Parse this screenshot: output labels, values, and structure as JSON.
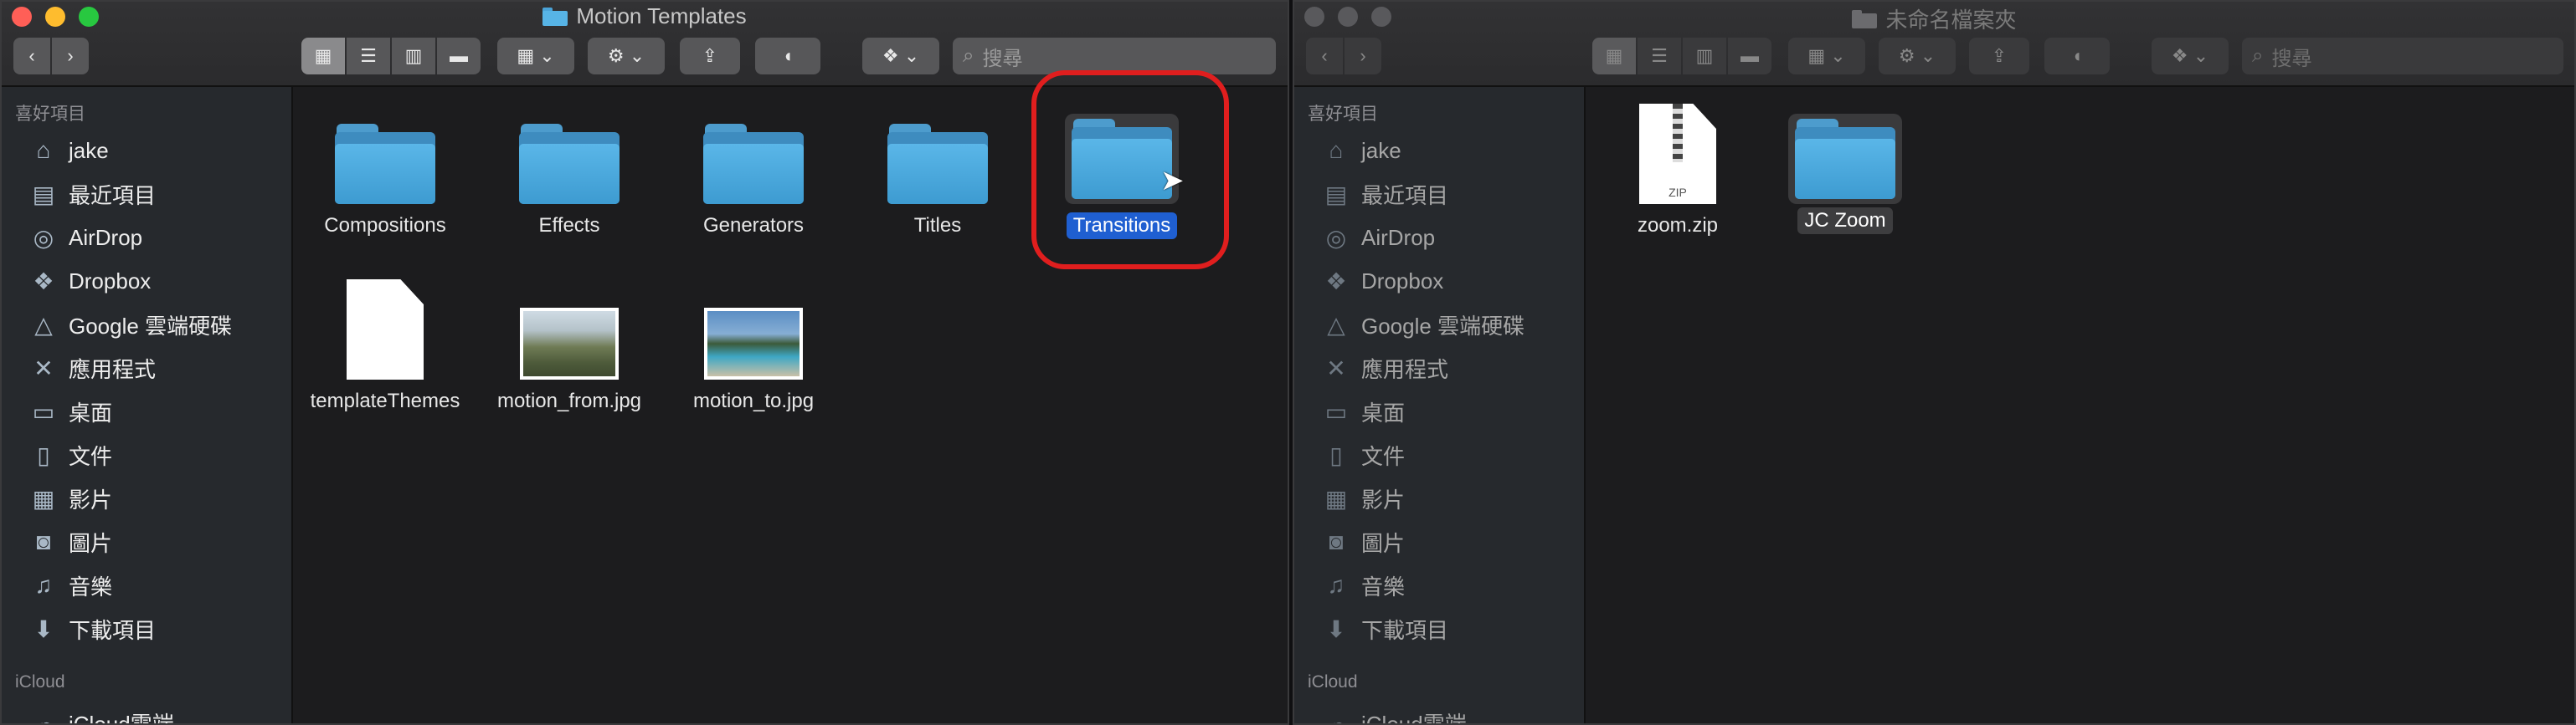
{
  "left_window": {
    "title": "Motion Templates",
    "search_placeholder": "搜尋",
    "sidebar": {
      "favorites_label": "喜好項目",
      "items": [
        {
          "label": "jake",
          "icon": "home-icon"
        },
        {
          "label": "最近項目",
          "icon": "recents-icon"
        },
        {
          "label": "AirDrop",
          "icon": "airdrop-icon"
        },
        {
          "label": "Dropbox",
          "icon": "dropbox-icon"
        },
        {
          "label": "Google 雲端硬碟",
          "icon": "google-drive-icon"
        },
        {
          "label": "應用程式",
          "icon": "applications-icon"
        },
        {
          "label": "桌面",
          "icon": "desktop-icon"
        },
        {
          "label": "文件",
          "icon": "documents-icon"
        },
        {
          "label": "影片",
          "icon": "movies-icon"
        },
        {
          "label": "圖片",
          "icon": "pictures-icon"
        },
        {
          "label": "音樂",
          "icon": "music-icon"
        },
        {
          "label": "下載項目",
          "icon": "downloads-icon"
        }
      ],
      "icloud_label": "iCloud",
      "icloud_item": "iCloud雲端"
    },
    "files": [
      {
        "name": "Compositions",
        "kind": "folder"
      },
      {
        "name": "Effects",
        "kind": "folder"
      },
      {
        "name": "Generators",
        "kind": "folder"
      },
      {
        "name": "Titles",
        "kind": "folder"
      },
      {
        "name": "Transitions",
        "kind": "folder",
        "selected": true
      },
      {
        "name": "templateThemes",
        "kind": "document"
      },
      {
        "name": "motion_from.jpg",
        "kind": "image"
      },
      {
        "name": "motion_to.jpg",
        "kind": "image"
      }
    ]
  },
  "right_window": {
    "title": "未命名檔案夾",
    "search_placeholder": "搜尋",
    "sidebar": {
      "favorites_label": "喜好項目",
      "items": [
        {
          "label": "jake",
          "icon": "home-icon"
        },
        {
          "label": "最近項目",
          "icon": "recents-icon"
        },
        {
          "label": "AirDrop",
          "icon": "airdrop-icon"
        },
        {
          "label": "Dropbox",
          "icon": "dropbox-icon"
        },
        {
          "label": "Google 雲端硬碟",
          "icon": "google-drive-icon"
        },
        {
          "label": "應用程式",
          "icon": "applications-icon"
        },
        {
          "label": "桌面",
          "icon": "desktop-icon"
        },
        {
          "label": "文件",
          "icon": "documents-icon"
        },
        {
          "label": "影片",
          "icon": "movies-icon"
        },
        {
          "label": "圖片",
          "icon": "pictures-icon"
        },
        {
          "label": "音樂",
          "icon": "music-icon"
        },
        {
          "label": "下載項目",
          "icon": "downloads-icon"
        }
      ],
      "icloud_label": "iCloud",
      "icloud_item": "iCloud雲端"
    },
    "files": [
      {
        "name": "zoom.zip",
        "kind": "zip",
        "badge": "ZIP"
      },
      {
        "name": "JC Zoom",
        "kind": "folder",
        "selected": true
      }
    ]
  },
  "colors": {
    "selection_blue": "#1f5fd1",
    "annotation_red": "#e01e1e",
    "folder_blue": "#57b4e6"
  }
}
